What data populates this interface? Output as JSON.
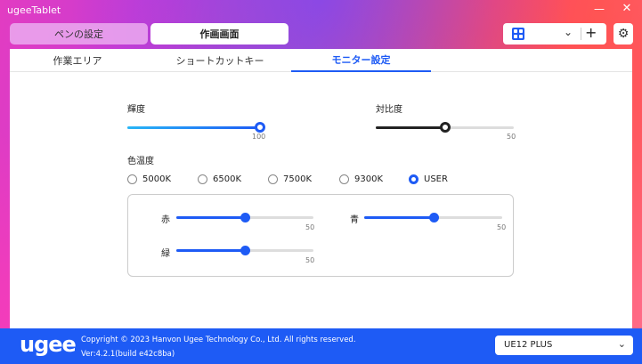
{
  "window": {
    "title": "ugeeTablet",
    "minimize": "—",
    "close": "✕"
  },
  "top_tabs": {
    "pen": "ペンの設定",
    "work": "作画画面"
  },
  "app_selector": {
    "icon": "app-grid-icon",
    "chevron": "⌄",
    "add": "+"
  },
  "settings_icon": "⚙",
  "sub_tabs": [
    "作業エリア",
    "ショートカットキー",
    "モニター設定"
  ],
  "brightness": {
    "label": "輝度",
    "value": 100,
    "max": 100,
    "value_label": "100"
  },
  "contrast": {
    "label": "対比度",
    "value": 50,
    "max": 100,
    "value_label": "50"
  },
  "color_temp": {
    "label": "色温度",
    "options": [
      "5000K",
      "6500K",
      "7500K",
      "9300K",
      "USER"
    ],
    "selected": "USER"
  },
  "user_rgb": {
    "red": {
      "label": "赤",
      "value": 50,
      "max": 100,
      "value_label": "50"
    },
    "blue": {
      "label": "青",
      "value": 50,
      "max": 100,
      "value_label": "50"
    },
    "green": {
      "label": "緑",
      "value": 50,
      "max": 100,
      "value_label": "50"
    }
  },
  "footer": {
    "logo": "ugee",
    "copyright": "Copyright © 2023 Hanvon Ugee Technology Co., Ltd. All rights reserved.",
    "version": "Ver:4.2.1(build e42c8ba)",
    "device": "UE12 PLUS",
    "device_chevron": "⌄"
  },
  "colors": {
    "accent": "#1e5bf5",
    "footer_bg": "#1e5bf5",
    "contrast_thumb": "#222222"
  }
}
